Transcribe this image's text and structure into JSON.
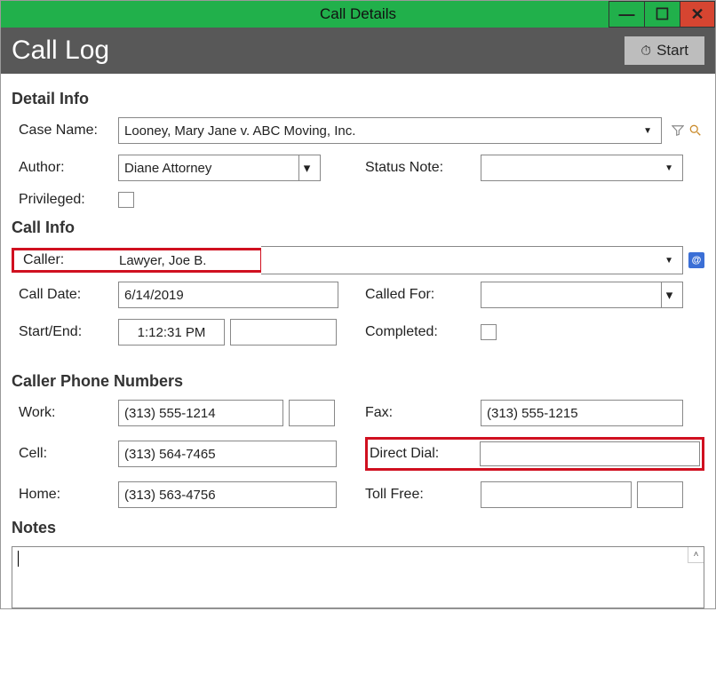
{
  "window": {
    "title": "Call Details"
  },
  "header": {
    "title": "Call Log",
    "start_label": "Start"
  },
  "sections": {
    "detail_info": "Detail Info",
    "call_info": "Call Info",
    "caller_phone": "Caller Phone Numbers",
    "notes": "Notes"
  },
  "labels": {
    "case_name": "Case Name:",
    "author": "Author:",
    "status_note": "Status Note:",
    "privileged": "Privileged:",
    "caller": "Caller:",
    "call_date": "Call Date:",
    "called_for": "Called For:",
    "start_end": "Start/End:",
    "completed": "Completed:",
    "work": "Work:",
    "fax": "Fax:",
    "cell": "Cell:",
    "direct_dial": "Direct Dial:",
    "home": "Home:",
    "toll_free": "Toll Free:"
  },
  "values": {
    "case_name": "Looney, Mary Jane v. ABC Moving, Inc.",
    "author": "Diane Attorney",
    "status_note": "",
    "caller": "Lawyer, Joe B.",
    "call_date": "6/14/2019",
    "called_for": "",
    "start_time": "1:12:31 PM",
    "end_time": "",
    "work": "(313) 555-1214",
    "work_ext": "",
    "fax": "(313) 555-1215",
    "cell": "(313) 564-7465",
    "direct_dial": "",
    "home": "(313) 563-4756",
    "toll_free": "",
    "toll_free_ext": "",
    "notes": ""
  }
}
